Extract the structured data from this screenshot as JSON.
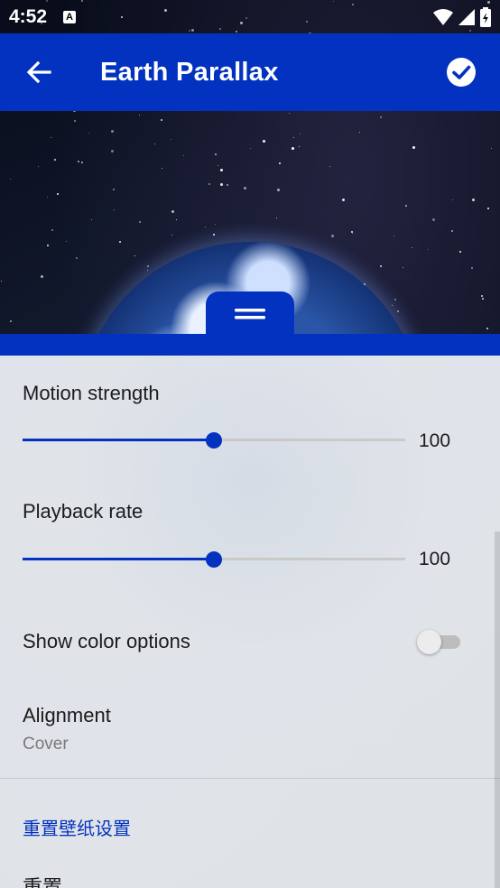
{
  "status_bar": {
    "time": "4:52",
    "notification_icon": "A"
  },
  "app_bar": {
    "title": "Earth Parallax"
  },
  "settings": {
    "motion_strength": {
      "label": "Motion strength",
      "value": "100",
      "fraction": 0.5
    },
    "playback_rate": {
      "label": "Playback rate",
      "value": "100",
      "fraction": 0.5
    },
    "show_color_options": {
      "label": "Show color options",
      "enabled": false
    },
    "alignment": {
      "label": "Alignment",
      "value": "Cover"
    },
    "section_title": "重置壁纸设置",
    "reset_label": "重置"
  },
  "colors": {
    "primary": "#0332c0"
  }
}
